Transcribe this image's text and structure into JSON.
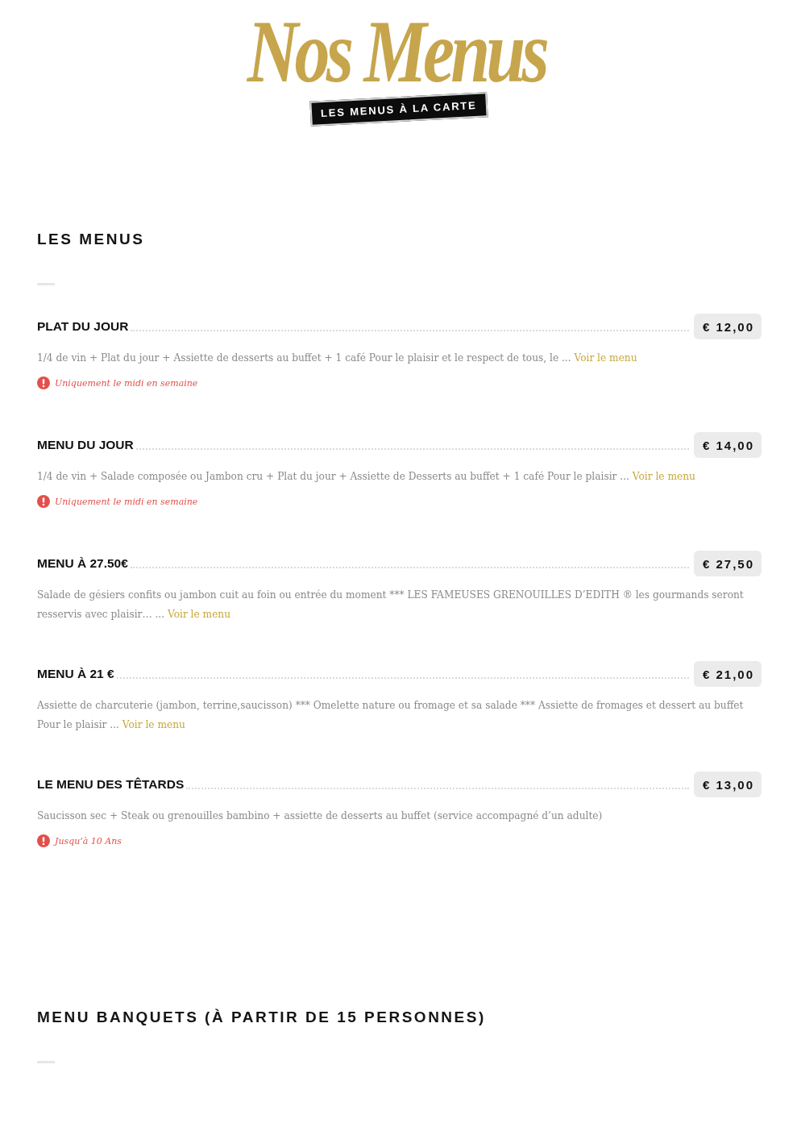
{
  "header": {
    "title": "Nos Menus",
    "subtitle": "LES MENUS À LA CARTE"
  },
  "sections": [
    {
      "heading": "LES MENUS",
      "items": [
        {
          "name": "PLAT DU JOUR",
          "price": "€ 12,00",
          "description": "1/4 de vin + Plat du jour + Assiette de desserts au buffet + 1 café Pour le plaisir et le respect de tous, le ...",
          "link": "Voir le menu",
          "note": "Uniquement le midi en semaine"
        },
        {
          "name": "MENU DU JOUR",
          "price": "€ 14,00",
          "description": "1/4 de vin + Salade composée ou Jambon cru + Plat du jour + Assiette de Desserts au buffet + 1 café Pour le plaisir ...",
          "link": "Voir le menu",
          "note": "Uniquement le midi en semaine"
        },
        {
          "name": "MENU À 27.50€",
          "price": "€ 27,50",
          "description": "Salade de gésiers confits ou jambon cuit au foin ou entrée du moment *** LES FAMEUSES GRENOUILLES D’EDITH ® les gourmands seront resservis avec plaisir… ...",
          "link": "Voir le menu"
        },
        {
          "name": "MENU À 21 €",
          "price": "€ 21,00",
          "description": "Assiette de charcuterie (jambon, terrine,saucisson) *** Omelette nature ou fromage et sa salade *** Assiette de fromages et dessert au buffet Pour le plaisir ...",
          "link": "Voir le menu"
        },
        {
          "name": "LE MENU DES TÊTARDS",
          "price": "€ 13,00",
          "description": "Saucisson sec + Steak ou grenouilles bambino + assiette de desserts au buffet (service accompagné d’un adulte)",
          "note": "Jusqu’à 10 Ans"
        }
      ]
    },
    {
      "heading": "MENU BANQUETS (À PARTIR DE 15 PERSONNES)"
    }
  ]
}
